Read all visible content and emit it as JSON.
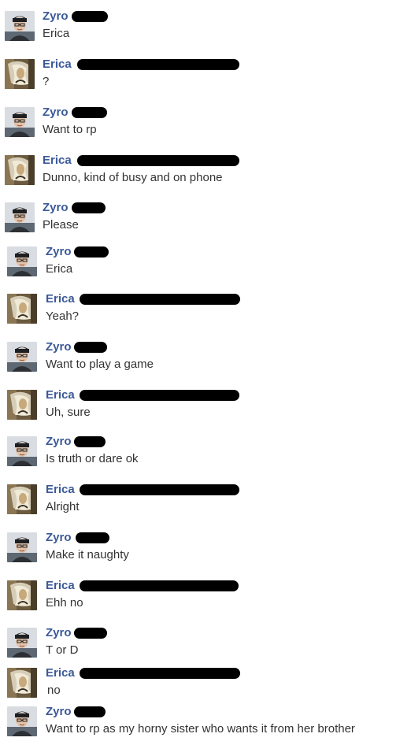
{
  "colors": {
    "name": "#3b5998",
    "text": "#333333",
    "redaction": "#000000"
  },
  "messages": [
    {
      "sender": "Zyro",
      "avatar": "zyro-avatar-icon",
      "text": "Erica"
    },
    {
      "sender": "Erica",
      "avatar": "erica-avatar-icon",
      "text": "?"
    },
    {
      "sender": "Zyro",
      "avatar": "zyro-avatar-icon",
      "text": "Want to rp"
    },
    {
      "sender": "Erica",
      "avatar": "erica-avatar-icon",
      "text": "Dunno, kind of busy and on phone"
    },
    {
      "sender": "Zyro",
      "avatar": "zyro-avatar-icon",
      "text": "Please"
    },
    {
      "sender": "Zyro",
      "avatar": "zyro-avatar-icon",
      "text": "Erica"
    },
    {
      "sender": "Erica",
      "avatar": "erica-avatar-icon",
      "text": "Yeah?"
    },
    {
      "sender": "Zyro",
      "avatar": "zyro-avatar-icon",
      "text": "Want to play a game"
    },
    {
      "sender": "Erica",
      "avatar": "erica-avatar-icon",
      "text": "Uh, sure"
    },
    {
      "sender": "Zyro",
      "avatar": "zyro-avatar-icon",
      "text": "Is truth or dare ok"
    },
    {
      "sender": "Erica",
      "avatar": "erica-avatar-icon",
      "text": "Alright"
    },
    {
      "sender": "Zyro",
      "avatar": "zyro-avatar-icon",
      "text": "Make it naughty"
    },
    {
      "sender": "Erica",
      "avatar": "erica-avatar-icon",
      "text": "Ehh no"
    },
    {
      "sender": "Zyro",
      "avatar": "zyro-avatar-icon",
      "text": "T or D"
    },
    {
      "sender": "Erica",
      "avatar": "erica-avatar-icon",
      "text": "no"
    },
    {
      "sender": "Zyro",
      "avatar": "zyro-avatar-icon",
      "text": "Want to rp as my horny sister who wants it from her brother"
    }
  ]
}
